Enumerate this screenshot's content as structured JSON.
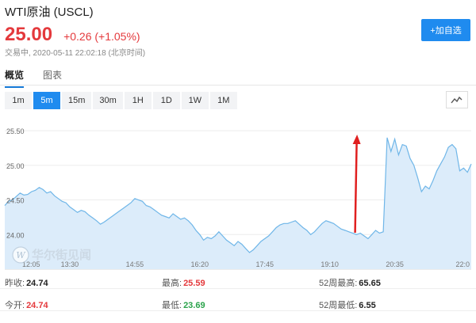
{
  "colors": {
    "up": "#e4393c",
    "down": "#2aa34b",
    "accent": "#1f8bef",
    "line": "#6fb6e8",
    "fill": "#dcecfa",
    "arrow": "#e02020"
  },
  "header": {
    "title": "WTI原油 (USCL)",
    "price": "25.00",
    "change": "+0.26 (+1.05%)",
    "status": "交易中, 2020-05-11 22:02:18 (北京时间)",
    "add_label": "+加自选"
  },
  "tabs": [
    {
      "label": "概览",
      "active": true
    },
    {
      "label": "图表",
      "active": false
    }
  ],
  "ranges": [
    {
      "label": "1m",
      "active": false
    },
    {
      "label": "5m",
      "active": true
    },
    {
      "label": "15m",
      "active": false
    },
    {
      "label": "30m",
      "active": false
    },
    {
      "label": "1H",
      "active": false
    },
    {
      "label": "1D",
      "active": false
    },
    {
      "label": "1W",
      "active": false
    },
    {
      "label": "1M",
      "active": false
    }
  ],
  "chart_toggle_icon": "line-chart-icon",
  "watermark": {
    "text": "华尔街见闻",
    "letter": "W"
  },
  "chart_data": {
    "type": "area",
    "y_ticks": [
      "25.50",
      "25.00",
      "24.50",
      "24.00"
    ],
    "ylim": [
      23.5,
      25.65
    ],
    "x_ticks": [
      "12:05",
      "13:30",
      "14:55",
      "16:20",
      "17:45",
      "19:10",
      "20:35",
      "22:0"
    ],
    "x_tick_idx": [
      0,
      17,
      34,
      51,
      68,
      85,
      102,
      119
    ],
    "grid": true,
    "annotation": "red arrow pointing up at the price jump",
    "arrow_idx": 91,
    "values": [
      24.42,
      24.48,
      24.5,
      24.55,
      24.6,
      24.57,
      24.58,
      24.62,
      24.64,
      24.68,
      24.65,
      24.6,
      24.62,
      24.56,
      24.52,
      24.48,
      24.46,
      24.4,
      24.36,
      24.32,
      24.35,
      24.33,
      24.28,
      24.24,
      24.2,
      24.15,
      24.18,
      24.22,
      24.26,
      24.3,
      24.34,
      24.38,
      24.42,
      24.46,
      24.52,
      24.5,
      24.48,
      24.42,
      24.4,
      24.36,
      24.32,
      24.28,
      24.26,
      24.24,
      24.3,
      24.26,
      24.22,
      24.24,
      24.2,
      24.14,
      24.06,
      24.0,
      23.92,
      23.96,
      23.94,
      23.98,
      24.04,
      23.98,
      23.92,
      23.88,
      23.84,
      23.9,
      23.86,
      23.8,
      23.74,
      23.78,
      23.84,
      23.9,
      23.94,
      23.98,
      24.04,
      24.1,
      24.14,
      24.16,
      24.16,
      24.18,
      24.2,
      24.15,
      24.1,
      24.06,
      24.0,
      24.04,
      24.1,
      24.16,
      24.2,
      24.18,
      24.16,
      24.12,
      24.08,
      24.06,
      24.04,
      24.02,
      24.0,
      24.02,
      23.98,
      23.94,
      24.0,
      24.06,
      24.02,
      24.04,
      25.4,
      25.2,
      25.38,
      25.15,
      25.3,
      25.28,
      25.1,
      25.0,
      24.82,
      24.62,
      24.7,
      24.66,
      24.78,
      24.92,
      25.02,
      25.12,
      25.26,
      25.3,
      25.24,
      24.92,
      24.96,
      24.9,
      25.02
    ]
  },
  "stats": {
    "prev_close_label": "昨收:",
    "prev_close": "24.74",
    "high_label": "最高:",
    "high": "25.59",
    "high_52w_label": "52周最高:",
    "high_52w": "65.65",
    "open_label": "今开:",
    "open": "24.74",
    "low_label": "最低:",
    "low": "23.69",
    "low_52w_label": "52周最低:",
    "low_52w": "6.55"
  }
}
